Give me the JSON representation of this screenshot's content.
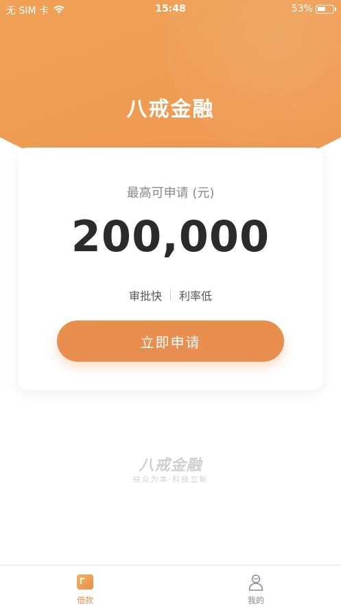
{
  "status_bar": {
    "carrier": "无 SIM 卡",
    "time": "15:48",
    "battery": "53%",
    "battery_level": 0.53
  },
  "header": {
    "title": "八戒金融"
  },
  "card": {
    "label": "最高可申请 (元)",
    "amount": "200,000",
    "features": [
      "审批快",
      "利率低"
    ],
    "apply_button": "立即申请"
  },
  "brand": {
    "logo_text": "八戒金融",
    "slogan": "扶众为本·科技立新"
  },
  "tab_bar": {
    "tabs": [
      {
        "label": "借款",
        "icon": "loan-icon",
        "active": true
      },
      {
        "label": "我的",
        "icon": "person-icon",
        "active": false
      }
    ]
  },
  "colors": {
    "accent": "#e88f50",
    "header_gradient_start": "#f3b860",
    "header_gradient_end": "#ee9550"
  }
}
